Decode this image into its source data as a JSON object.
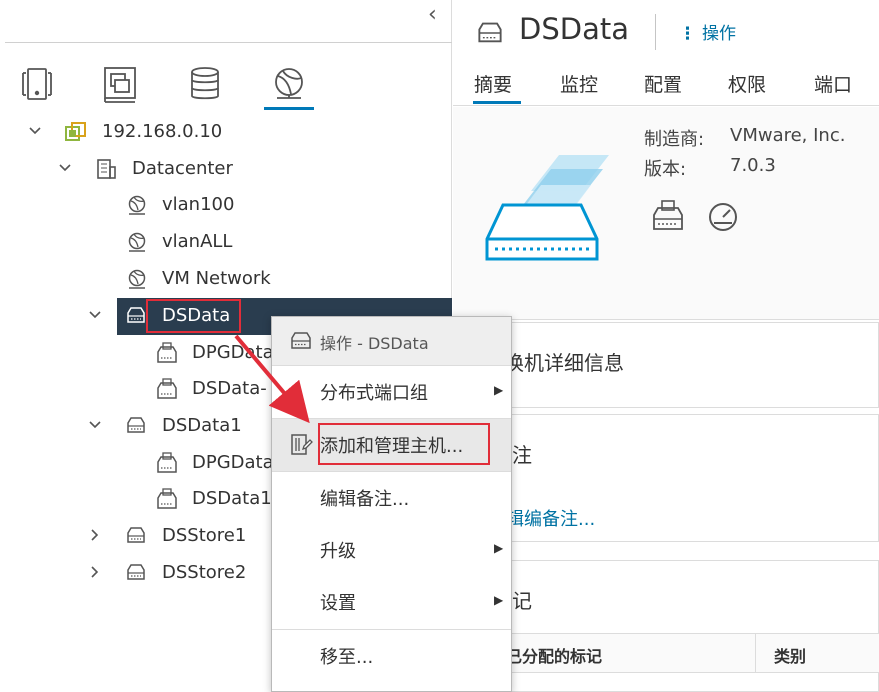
{
  "nav": {
    "collapse_glyph": "‹",
    "views": [
      {
        "name": "hosts-and-clusters-view",
        "icon": "hosts-icon"
      },
      {
        "name": "vms-and-templates-view",
        "icon": "vms-icon"
      },
      {
        "name": "storage-view",
        "icon": "database-icon"
      },
      {
        "name": "networking-view",
        "icon": "network-icon",
        "active": true
      }
    ]
  },
  "tree": [
    {
      "label": "192.168.0.10",
      "icon": "vcenter-icon",
      "expanded": true,
      "level": 0
    },
    {
      "label": "Datacenter",
      "icon": "datacenter-icon",
      "expanded": true,
      "level": 1
    },
    {
      "label": "vlan100",
      "icon": "network-icon",
      "level": 2
    },
    {
      "label": "vlanALL",
      "icon": "network-icon",
      "level": 2
    },
    {
      "label": "VM Network",
      "icon": "network-icon",
      "level": 2
    },
    {
      "label": "DSData",
      "icon": "switch-icon",
      "expanded": true,
      "level": 2,
      "selected": true
    },
    {
      "label": "DPGData",
      "icon": "portgroup-icon",
      "level": 3
    },
    {
      "label": "DSData-",
      "icon": "portgroup-icon",
      "level": 3
    },
    {
      "label": "DSData1",
      "icon": "switch-icon",
      "expanded": true,
      "level": 2
    },
    {
      "label": "DPGData",
      "icon": "portgroup-icon",
      "level": 3
    },
    {
      "label": "DSData1",
      "icon": "portgroup-icon",
      "level": 3
    },
    {
      "label": "DSStore1",
      "icon": "switch-icon",
      "expanded": false,
      "level": 2
    },
    {
      "label": "DSStore2",
      "icon": "switch-icon",
      "expanded": false,
      "level": 2
    }
  ],
  "detail": {
    "title": "DSData",
    "actions_label": "操作",
    "tabs": [
      "摘要",
      "监控",
      "配置",
      "权限",
      "端口"
    ],
    "active_tab": "摘要",
    "manufacturer_key": "制造商:",
    "manufacturer_val": "VMware, Inc.",
    "version_key": "版本:",
    "version_val": "7.0.3",
    "switch_details_title": "换机详细信息",
    "notes_title": "注",
    "edit_notes_link": "辑编备注...",
    "tags_title": "记",
    "tags_col_assigned": "已分配的标记",
    "tags_col_category": "类别"
  },
  "context_menu": {
    "header": "操作 - DSData",
    "items": [
      {
        "label": "分布式端口组",
        "submenu": true
      },
      {
        "label": "添加和管理主机...",
        "highlighted": true,
        "icon": "add-host-icon"
      },
      {
        "label": "编辑备注...",
        "submenu": false
      },
      {
        "label": "升级",
        "submenu": true
      },
      {
        "label": "设置",
        "submenu": true
      },
      {
        "label": "移至...",
        "submenu": false
      }
    ]
  },
  "colors": {
    "accent": "#0079b8",
    "link": "#0072a3",
    "selected_row": "#2a3d4f",
    "annotation_red": "#e12d39"
  }
}
